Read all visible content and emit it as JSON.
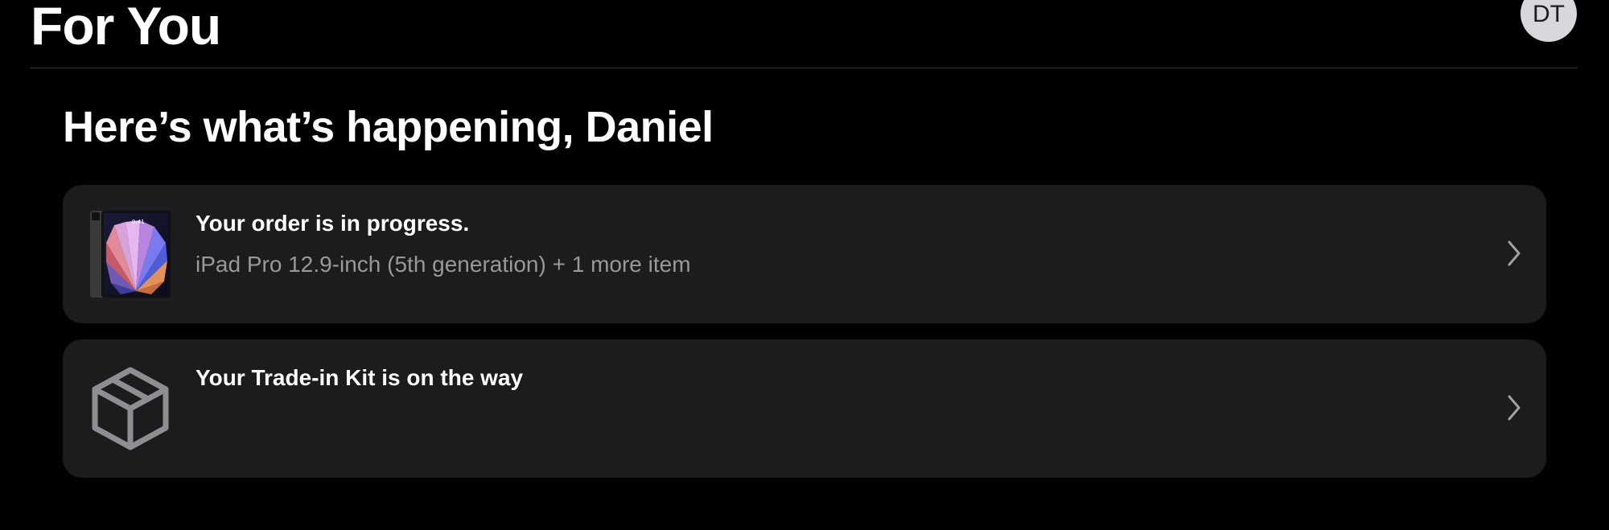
{
  "header": {
    "title": "For You",
    "avatar_initials": "DT"
  },
  "greeting": "Here’s what’s happening, Daniel",
  "cards": [
    {
      "title": "Your order is in progress.",
      "subtitle": "iPad Pro 12.9-inch (5th generation) + 1 more item",
      "icon": "ipad-pro-thumbnail",
      "action_icon": "chevron-right-icon"
    },
    {
      "title": "Your Trade-in Kit is on the way",
      "icon": "package-box-icon",
      "action_icon": "chevron-right-icon"
    }
  ],
  "colors": {
    "background": "#000000",
    "card_background": "#1c1c1e",
    "secondary_text": "#98989d",
    "avatar_background": "#d8d8dc"
  }
}
